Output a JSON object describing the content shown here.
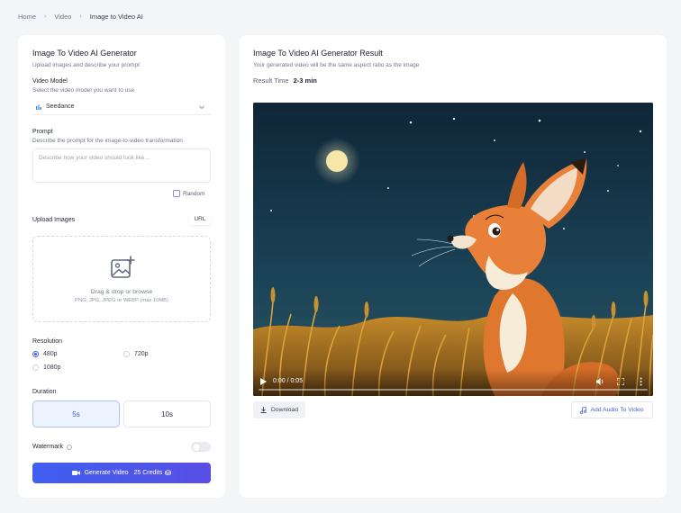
{
  "breadcrumb": {
    "home": "Home",
    "section": "Video",
    "current": "Image to Video AI"
  },
  "form": {
    "title": "Image To Video AI Generator",
    "subtitle": "Upload images and describe your prompt",
    "model": {
      "label": "Video Model",
      "hint": "Select the video model you want to use",
      "selected": "Seedance"
    },
    "prompt": {
      "label": "Prompt",
      "hint": "Describe the prompt for the image-to-video transformation",
      "placeholder": "Describe how your video should look like...",
      "random_label": "Random"
    },
    "upload": {
      "label": "Upload Images",
      "url_button": "URL",
      "drop_title": "Drag & drop or browse",
      "drop_formats": "PNG, JPG, JPEG or WEBP (max 10MB)"
    },
    "resolution": {
      "label": "Resolution",
      "options": [
        "480p",
        "720p",
        "1080p"
      ],
      "selected": "480p"
    },
    "duration": {
      "label": "Duration",
      "options": [
        "5s",
        "10s"
      ],
      "selected": "5s"
    },
    "watermark": {
      "label": "Watermark",
      "enabled": false
    },
    "generate": {
      "label": "Generate Video",
      "credits": "25 Credits"
    }
  },
  "result": {
    "title": "Image To Video AI Generator Result",
    "subtitle": "Your generated video will be the same aspect ratio as the image",
    "time_label": "Result Time",
    "time_value": "2-3 min",
    "player": {
      "time": "0:00 / 0:05",
      "progress": 0
    },
    "download_label": "Download",
    "add_audio_label": "Add Audio To Video"
  },
  "colors": {
    "accent": "#4a63e8",
    "button_gradient_end": "#5a4ee6"
  }
}
